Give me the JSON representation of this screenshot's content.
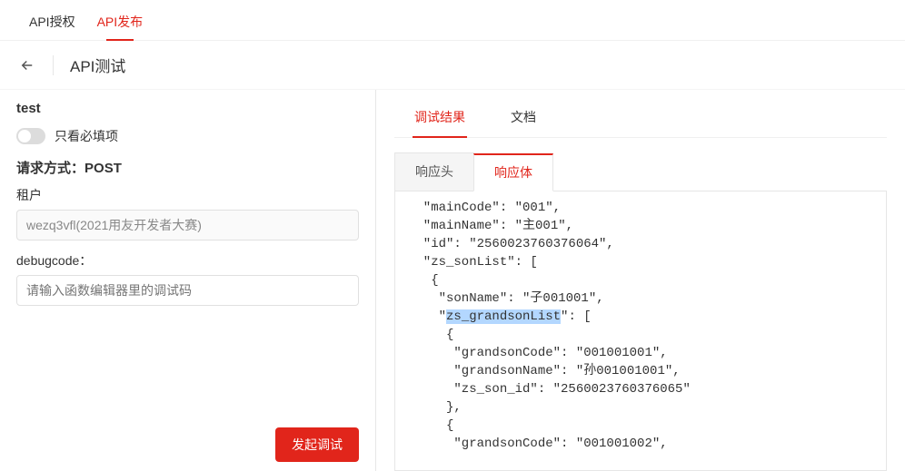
{
  "top_tabs": {
    "auth": "API授权",
    "publish": "API发布"
  },
  "back_sub": {
    "title": "API测试"
  },
  "left": {
    "test_name": "test",
    "required_only_label": "只看必填项",
    "request_method_label": "请求方式：",
    "request_method_value": "POST",
    "tenant_label": "租户",
    "tenant_value": "wezq3vfl(2021用友开发者大赛)",
    "debugcode_label": "debugcode：",
    "debugcode_placeholder": "请输入函数编辑器里的调试码",
    "submit_label": "发起调试"
  },
  "right": {
    "tabs": {
      "result": "调试结果",
      "doc": "文档"
    },
    "subtabs": {
      "header": "响应头",
      "body": "响应体"
    },
    "body_lines": [
      "  \"mainCode\": \"001\",",
      "  \"mainName\": \"主001\",",
      "  \"id\": \"2560023760376064\",",
      "  \"zs_sonList\": [",
      "   {",
      "    \"sonName\": \"子001001\",",
      "    \"zs_grandsonList\": [",
      "     {",
      "      \"grandsonCode\": \"001001001\",",
      "      \"grandsonName\": \"孙001001001\",",
      "      \"zs_son_id\": \"2560023760376065\"",
      "     },",
      "     {",
      "      \"grandsonCode\": \"001001002\","
    ],
    "highlight_line_index": 6,
    "highlight_text": "zs_grandsonList"
  }
}
